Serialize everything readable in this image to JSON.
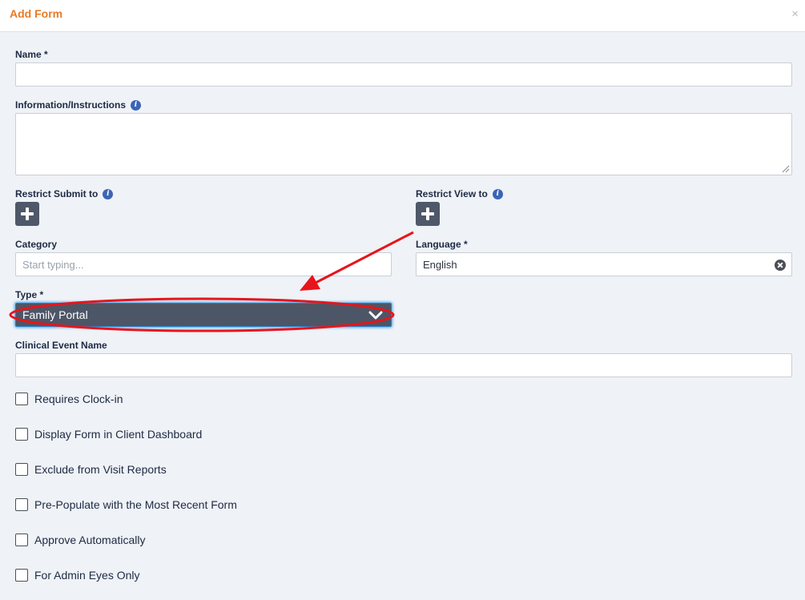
{
  "header": {
    "title": "Add Form",
    "close": "×"
  },
  "fields": {
    "name_label": "Name *",
    "info_label": "Information/Instructions",
    "restrict_submit_label": "Restrict Submit to",
    "restrict_view_label": "Restrict View to",
    "category_label": "Category",
    "category_placeholder": "Start typing...",
    "language_label": "Language *",
    "language_value": "English",
    "type_label": "Type *",
    "type_value": "Family Portal",
    "clinical_label": "Clinical Event Name"
  },
  "checkboxes": [
    {
      "label": "Requires Clock-in"
    },
    {
      "label": "Display Form in Client Dashboard"
    },
    {
      "label": "Exclude from Visit Reports"
    },
    {
      "label": "Pre-Populate with the Most Recent Form"
    },
    {
      "label": "Approve Automatically"
    },
    {
      "label": "For Admin Eyes Only"
    }
  ],
  "colors": {
    "accent": "#ea7a23",
    "annotation": "#e8141b",
    "select_bg": "#4d5666"
  },
  "icons": {
    "info": "info-icon",
    "add": "plus-icon",
    "clear": "clear-icon",
    "dropdown": "chevron-down-icon"
  }
}
